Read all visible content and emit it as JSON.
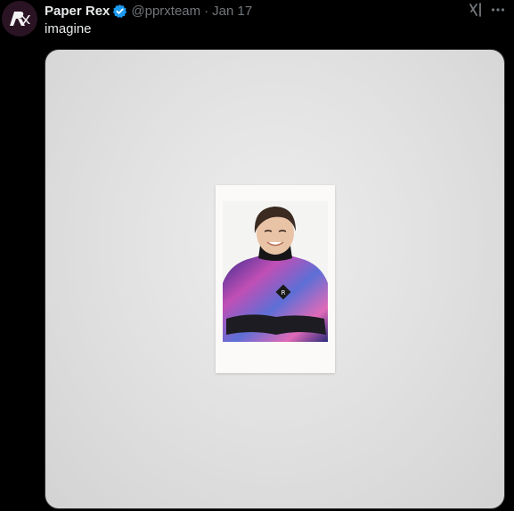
{
  "tweet": {
    "author_name": "Paper Rex",
    "handle": "@pprxteam",
    "separator": "·",
    "date": "Jan 17",
    "text": "imagine",
    "avatar_icon": "paper-rex-logo",
    "verified_icon": "verified-badge-icon",
    "grok_icon": "grok-icon",
    "more_icon": "more-icon"
  },
  "media": {
    "type": "photo",
    "subject": "polaroid-photo"
  },
  "colors": {
    "background": "#000000",
    "text_primary": "#e7e9ea",
    "text_secondary": "#71767b",
    "verified": "#1d9bf0",
    "avatar_bg": "#2a1424",
    "media_bg": "#e2e2e2"
  }
}
